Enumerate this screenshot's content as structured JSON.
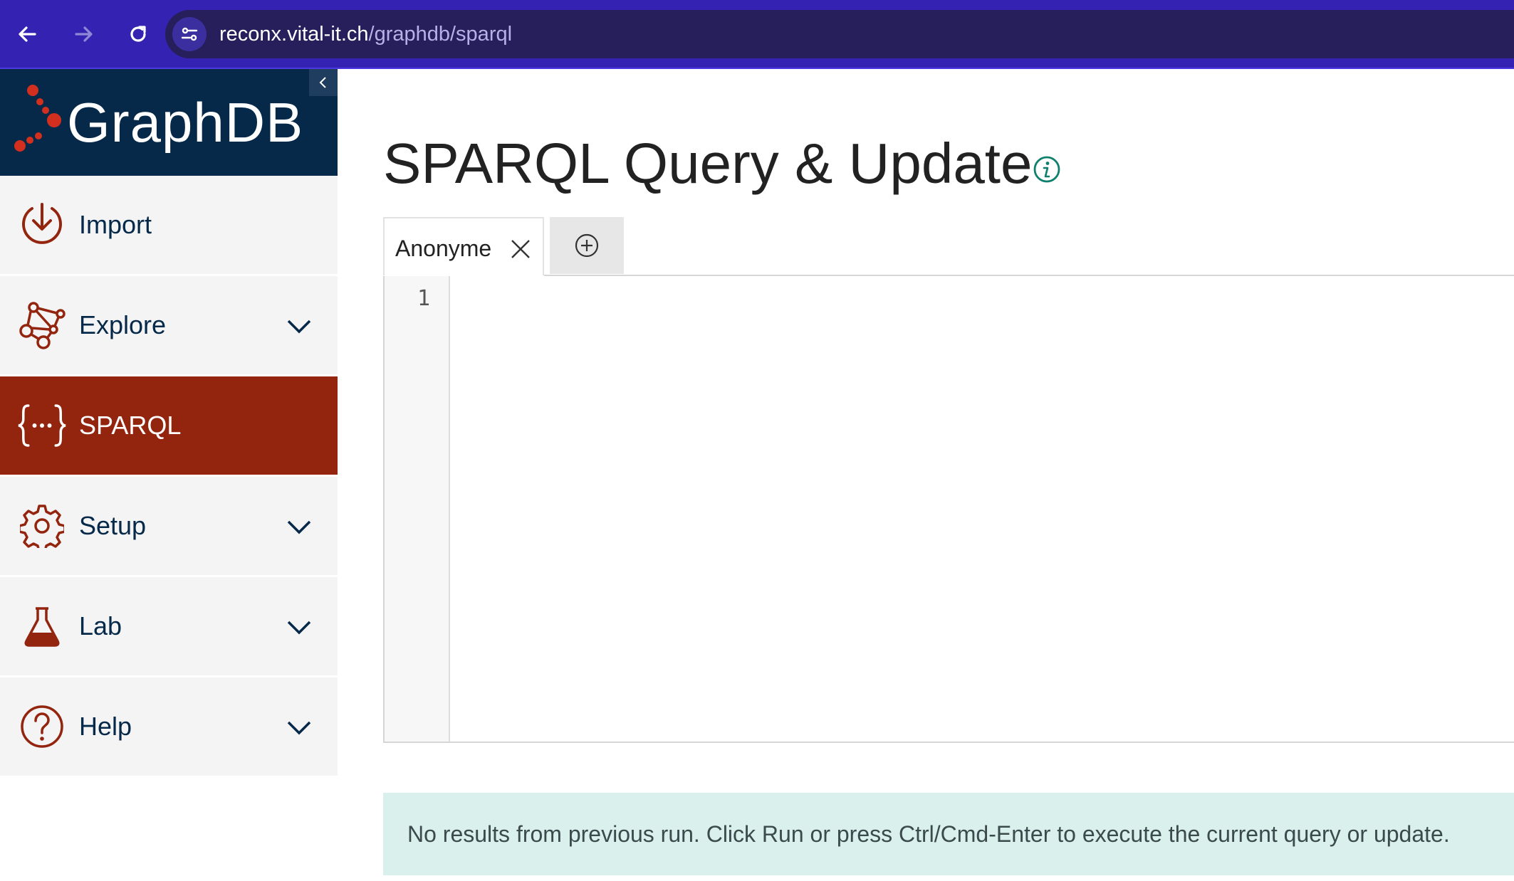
{
  "browser": {
    "url_host": "reconx.vital-it.ch",
    "url_path": "/graphdb/sparql"
  },
  "sidebar": {
    "brand": "GraphDB",
    "items": [
      {
        "label": "Import",
        "icon": "import-icon",
        "expandable": false,
        "active": false
      },
      {
        "label": "Explore",
        "icon": "explore-graph-icon",
        "expandable": true,
        "active": false
      },
      {
        "label": "SPARQL",
        "icon": "sparql-braces-icon",
        "expandable": false,
        "active": true
      },
      {
        "label": "Setup",
        "icon": "gear-icon",
        "expandable": true,
        "active": false
      },
      {
        "label": "Lab",
        "icon": "flask-icon",
        "expandable": true,
        "active": false
      },
      {
        "label": "Help",
        "icon": "help-circle-icon",
        "expandable": true,
        "active": false
      }
    ]
  },
  "main": {
    "title": "SPARQL Query & Update",
    "tabs": [
      {
        "label": "Anonyme"
      }
    ],
    "editor": {
      "line_numbers": [
        "1"
      ],
      "content": ""
    },
    "results_note": "No results from previous run. Click Run or press Ctrl/Cmd-Enter to execute the current query or update."
  },
  "colors": {
    "browser_bar": "#3422b2",
    "brand_navy": "#06294a",
    "accent_red": "#93240e",
    "info_teal": "#0f7f6e",
    "note_bg": "#daf0ec"
  }
}
